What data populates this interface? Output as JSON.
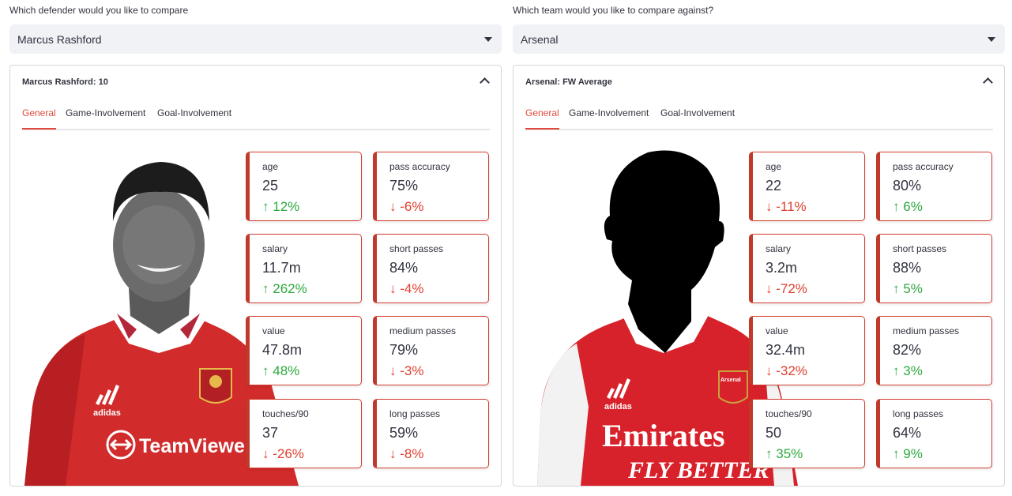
{
  "left": {
    "question": "Which defender would you like to compare",
    "selected": "Marcus Rashford",
    "panel_title": "Marcus Rashford: 10",
    "tabs": [
      "General",
      "Game-Involvement",
      "Goal-Involvement"
    ],
    "kit": {
      "brand": "adidas",
      "sponsor": "TeamViewer"
    },
    "stats": [
      {
        "label": "age",
        "value": "25",
        "delta": "12%",
        "dir": "up"
      },
      {
        "label": "pass accuracy",
        "value": "75%",
        "delta": "-6%",
        "dir": "down"
      },
      {
        "label": "salary",
        "value": "11.7m",
        "delta": "262%",
        "dir": "up"
      },
      {
        "label": "short passes",
        "value": "84%",
        "delta": "-4%",
        "dir": "down"
      },
      {
        "label": "value",
        "value": "47.8m",
        "delta": "48%",
        "dir": "up"
      },
      {
        "label": "medium passes",
        "value": "79%",
        "delta": "-3%",
        "dir": "down"
      },
      {
        "label": "touches/90",
        "value": "37",
        "delta": "-26%",
        "dir": "down"
      },
      {
        "label": "long passes",
        "value": "59%",
        "delta": "-8%",
        "dir": "down"
      }
    ]
  },
  "right": {
    "question": "Which team would you like to compare against?",
    "selected": "Arsenal",
    "panel_title": "Arsenal: FW Average",
    "tabs": [
      "General",
      "Game-Involvement",
      "Goal-Involvement"
    ],
    "kit": {
      "brand": "adidas",
      "sponsor_line1": "Emirates",
      "sponsor_line2": "FLY BETTER",
      "crest": "Arsenal"
    },
    "stats": [
      {
        "label": "age",
        "value": "22",
        "delta": "-11%",
        "dir": "down"
      },
      {
        "label": "pass accuracy",
        "value": "80%",
        "delta": "6%",
        "dir": "up"
      },
      {
        "label": "salary",
        "value": "3.2m",
        "delta": "-72%",
        "dir": "down"
      },
      {
        "label": "short passes",
        "value": "88%",
        "delta": "5%",
        "dir": "up"
      },
      {
        "label": "value",
        "value": "32.4m",
        "delta": "-32%",
        "dir": "down"
      },
      {
        "label": "medium passes",
        "value": "82%",
        "delta": "3%",
        "dir": "up"
      },
      {
        "label": "touches/90",
        "value": "50",
        "delta": "35%",
        "dir": "up"
      },
      {
        "label": "long passes",
        "value": "64%",
        "delta": "9%",
        "dir": "up"
      }
    ]
  },
  "colors": {
    "accent": "#e04a3c",
    "up": "#2eaa3f",
    "down": "#e0402f",
    "card_border": "#c0392b"
  }
}
